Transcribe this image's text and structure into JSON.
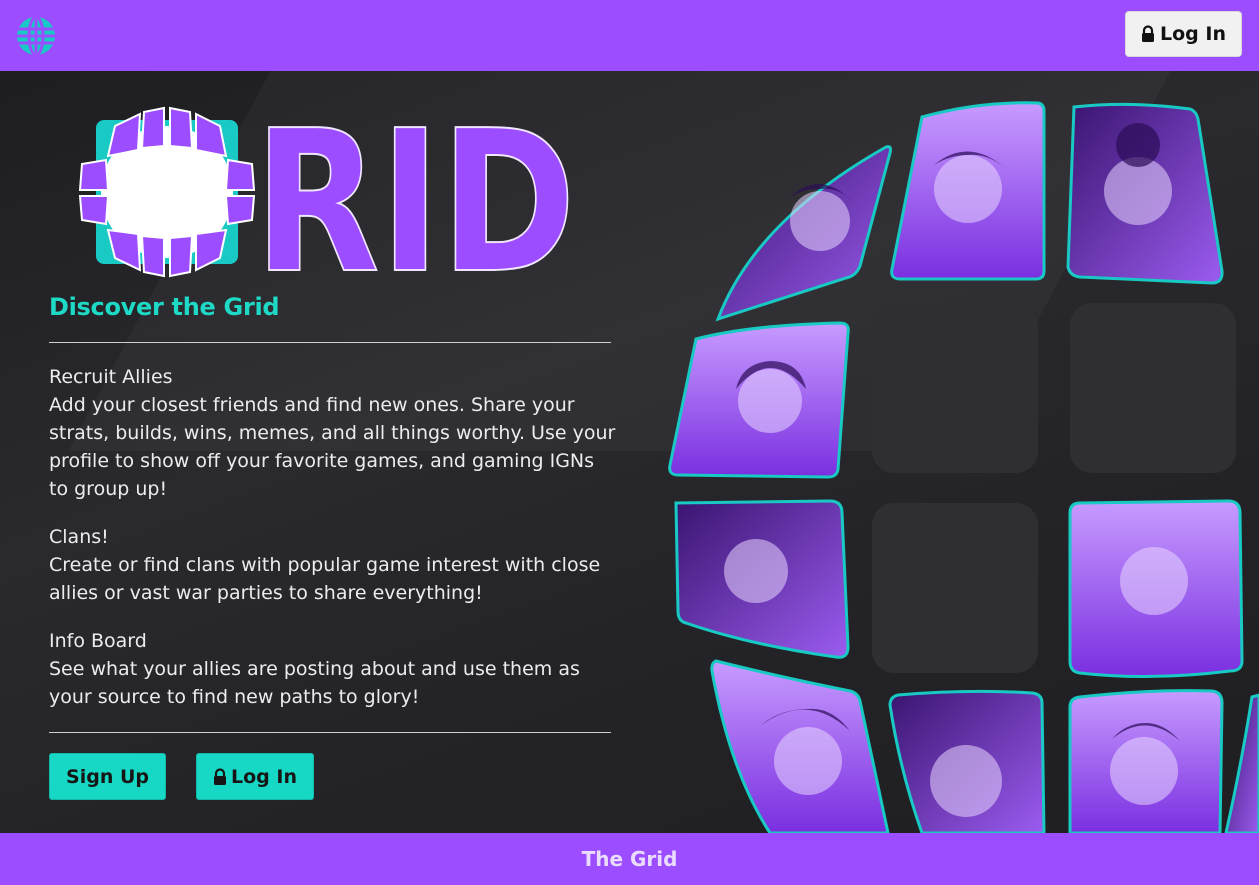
{
  "header": {
    "logo_icon": "grid-globe-icon",
    "login_label": "Log In",
    "login_icon": "lock-icon"
  },
  "hero": {
    "brand_word": "RID",
    "headline": "Discover the Grid"
  },
  "features": [
    {
      "title": "Recruit Allies",
      "body": "Add your closest friends and find new ones. Share your strats, builds, wins, memes, and all things worthy. Use your profile to show off your favorite games, and gaming IGNs to group up!"
    },
    {
      "title": "Clans!",
      "body": "Create or find clans with popular game interest with close allies or vast war parties to share everything!"
    },
    {
      "title": "Info Board",
      "body": "See what your allies are posting about and use them as your source to find new paths to glory!"
    }
  ],
  "actions": {
    "signup_label": "Sign Up",
    "login_label": "Log In"
  },
  "footer": {
    "text": "The Grid"
  },
  "colors": {
    "brand_purple": "#9c4dff",
    "accent_teal": "#1dd9c6",
    "background": "#212124"
  }
}
